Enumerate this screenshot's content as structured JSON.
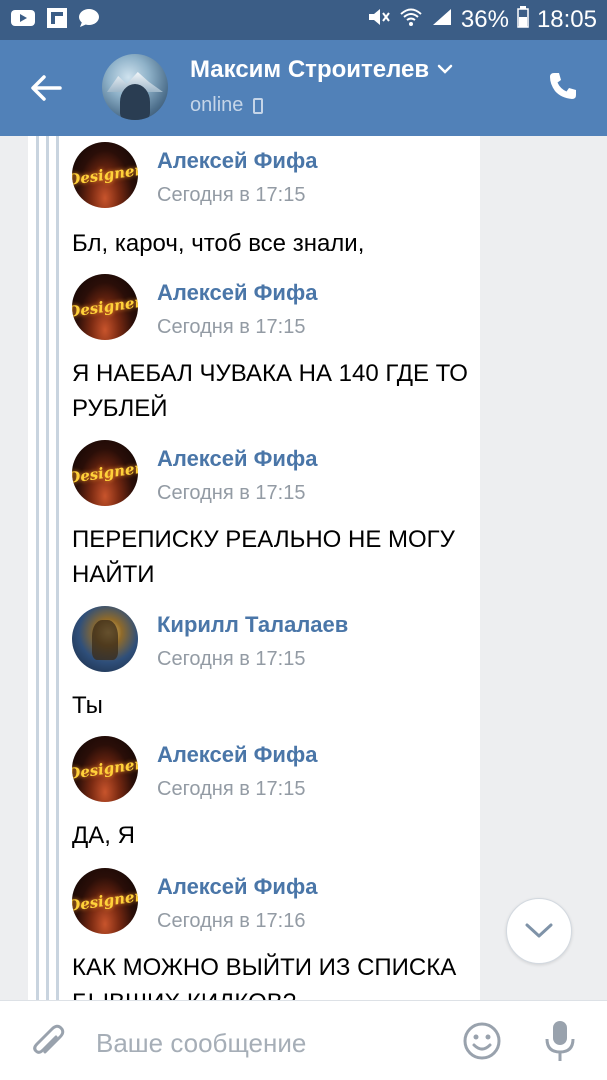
{
  "status_bar": {
    "battery": "36%",
    "time": "18:05",
    "icons": [
      "youtube-icon",
      "flipboard-icon",
      "message-icon",
      "mute-icon",
      "wifi-icon",
      "signal-icon",
      "battery-icon"
    ]
  },
  "header": {
    "title": "Максим Строителев",
    "status": "online",
    "icons": [
      "back-arrow-icon",
      "chevron-down-icon",
      "mobile-icon",
      "phone-icon"
    ]
  },
  "messages": [
    {
      "author": "Алексей Фифа",
      "avatar_text": "Designer",
      "time": "Сегодня в 17:15",
      "text": "Бл, кароч, чтоб все знали,"
    },
    {
      "author": "Алексей Фифа",
      "avatar_text": "Designer",
      "time": "Сегодня в 17:15",
      "text": "Я НАЕБАЛ ЧУВАКА НА 140 ГДЕ ТО РУБЛЕЙ"
    },
    {
      "author": "Алексей Фифа",
      "avatar_text": "Designer",
      "time": "Сегодня в 17:15",
      "text": "ПЕРЕПИСКУ РЕАЛЬНО НЕ МОГУ НАЙТИ"
    },
    {
      "author": "Кирилл Талалаев",
      "avatar_text": "",
      "time": "Сегодня в 17:15",
      "text": "Ты"
    },
    {
      "author": "Алексей Фифа",
      "avatar_text": "Designer",
      "time": "Сегодня в 17:15",
      "text": "ДА, Я"
    },
    {
      "author": "Алексей Фифа",
      "avatar_text": "Designer",
      "time": "Сегодня в 17:16",
      "text": "КАК МОЖНО ВЫЙТИ ИЗ СПИСКА БЫВШИХ КИДКОВ?"
    }
  ],
  "compose": {
    "placeholder": "Ваше сообщение",
    "icons": [
      "attach-icon",
      "emoji-icon",
      "mic-icon"
    ]
  },
  "colors": {
    "status_bar": "#3b5d86",
    "app_bar": "#5181b8",
    "author_name": "#4a76a8",
    "timestamp": "#939ba4",
    "background": "#edeef0"
  }
}
